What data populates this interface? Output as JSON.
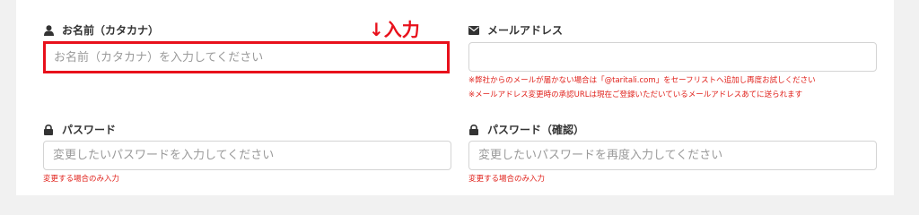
{
  "annotation": {
    "arrow_text": "↓入力",
    "color": "#e8101b"
  },
  "name_field": {
    "label": "お名前（カタカナ）",
    "icon": "user-icon",
    "placeholder": "お名前（カタカナ）を入力してください",
    "value": ""
  },
  "email_field": {
    "label": "メールアドレス",
    "icon": "envelope-icon",
    "placeholder": "",
    "value": "",
    "note_1": "※弊社からのメールが届かない場合は「@taritali.com」をセーフリストへ追加し再度お試しください",
    "note_2": "※メールアドレス変更時の承認URLは現在ご登録いただいているメールアドレスあてに送られます"
  },
  "password_field": {
    "label": "パスワード",
    "icon": "lock-icon",
    "placeholder": "変更したいパスワードを入力してください",
    "value": "",
    "note": "変更する場合のみ入力"
  },
  "password_confirm_field": {
    "label": "パスワード（確認）",
    "icon": "lock-icon",
    "placeholder": "変更したいパスワードを再度入力してください",
    "value": "",
    "note": "変更する場合のみ入力"
  },
  "colors": {
    "error_red": "#e0201a",
    "highlight_red": "#e8101b",
    "border_gray": "#d4d4d4",
    "label_text": "#333333"
  }
}
